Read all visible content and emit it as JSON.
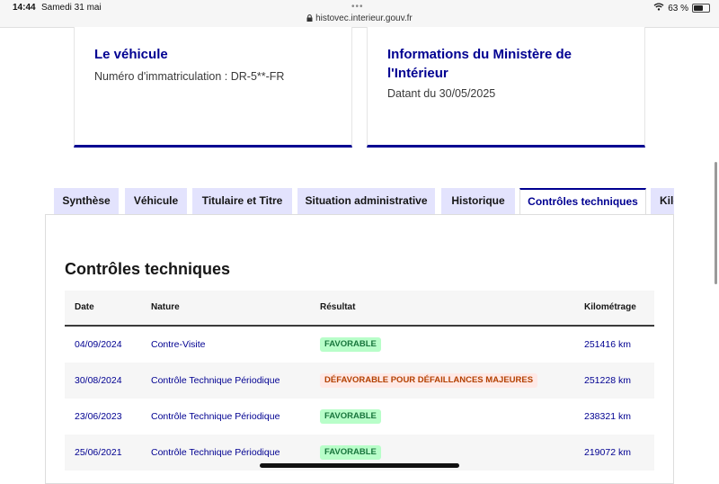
{
  "status_bar": {
    "time": "14:44",
    "date": "Samedi 31 mai",
    "url": "histovec.interieur.gouv.fr",
    "battery": "63 %",
    "battery_level": 0.63
  },
  "cards": {
    "vehicle": {
      "title": "Le véhicule",
      "text": "Numéro d'immatriculation : DR-5**-FR"
    },
    "ministry": {
      "title_line1": "Informations du Ministère de",
      "title_line2": "l'Intérieur",
      "text": "Datant du 30/05/2025"
    }
  },
  "tabs": [
    {
      "label": "Synthèse"
    },
    {
      "label": "Véhicule"
    },
    {
      "label": "Titulaire et Titre"
    },
    {
      "label": "Situation administrative"
    },
    {
      "label": "Historique"
    },
    {
      "label": "Contrôles techniques",
      "active": true
    },
    {
      "label": "Kilométrage"
    }
  ],
  "section": {
    "title": "Contrôles techniques"
  },
  "table": {
    "headers": {
      "date": "Date",
      "nature": "Nature",
      "result": "Résultat",
      "km": "Kilométrage"
    },
    "rows": [
      {
        "date": "04/09/2024",
        "nature": "Contre-Visite",
        "result": "FAVORABLE",
        "status": "ok",
        "km": "251416 km"
      },
      {
        "date": "30/08/2024",
        "nature": "Contrôle Technique Périodique",
        "result": "DÉFAVORABLE POUR DÉFAILLANCES MAJEURES",
        "status": "ko",
        "km": "251228 km"
      },
      {
        "date": "23/06/2023",
        "nature": "Contrôle Technique Périodique",
        "result": "FAVORABLE",
        "status": "ok",
        "km": "238321 km"
      },
      {
        "date": "25/06/2021",
        "nature": "Contrôle Technique Périodique",
        "result": "FAVORABLE",
        "status": "ok",
        "km": "219072 km"
      }
    ]
  },
  "colors": {
    "primary": "#000091",
    "tab_bg": "#e3e3fd",
    "success_bg": "#b8fec9",
    "success_text": "#18753c",
    "error_bg": "#ffe9e6",
    "error_text": "#b34000"
  },
  "icons": [
    "lock-icon",
    "wifi-icon",
    "battery-icon",
    "moon-icon"
  ]
}
